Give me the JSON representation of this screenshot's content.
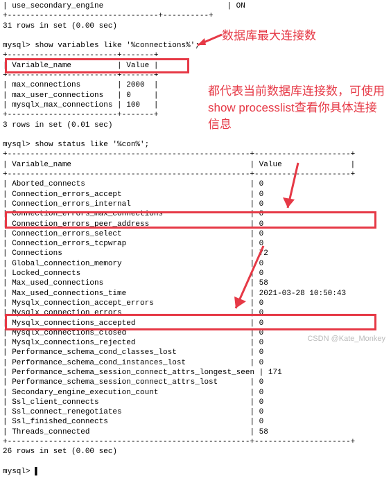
{
  "terminal": {
    "line0": "| use_secondary_engine                           | ON",
    "line1_sep": "+---------------------------------+----------+",
    "line2": "31 rows in set (0.00 sec)",
    "line3": "",
    "line4": "mysql> show variables like '%connections%';",
    "line5": "+------------------------+-------+",
    "line6": "| Variable_name          | Value |",
    "line7": "+------------------------+-------+",
    "line8": "| max_connections        | 2000  |",
    "line8b": "| max_user_connections   | 0     |",
    "line9": "| mysqlx_max_connections | 100   |",
    "line10": "+------------------------+-------+",
    "line11": "3 rows in set (0.01 sec)",
    "line12": "",
    "line13": "mysql> show status like '%con%';",
    "line14": "+-----------------------------------------------------+---------------------+",
    "line15": "| Variable_name                                       | Value               |",
    "line16": "+-----------------------------------------------------+---------------------+",
    "line17": "| Aborted_connects                                    | 0",
    "line18": "| Connection_errors_accept                            | 0",
    "line19": "| Connection_errors_internal                          | 0",
    "line20": "| Connection_errors_max_connections                   | 0",
    "line21": "| Connection_errors_peer_address                      | 0",
    "line22": "| Connection_errors_select                            | 0",
    "line23": "| Connection_errors_tcpwrap                           | 0",
    "line24": "| Connections                                         | 72",
    "line25": "| Global_connection_memory                            | 0",
    "line26": "| Locked_connects                                     | 0",
    "line27": "| Max_used_connections                                | 58",
    "line28": "| Max_used_connections_time                           | 2021-03-28 10:50:43",
    "line29": "| Mysqlx_connection_accept_errors                     | 0",
    "line30": "| Mysqlx_connection_errors                            | 0",
    "line31": "| Mysqlx_connections_accepted                         | 0",
    "line32": "| Mysqlx_connections_closed                           | 0",
    "line33": "| Mysqlx_connections_rejected                         | 0",
    "line34": "| Performance_schema_cond_classes_lost                | 0",
    "line35": "| Performance_schema_cond_instances_lost              | 0",
    "line36": "| Performance_schema_session_connect_attrs_longest_seen | 171",
    "line37": "| Performance_schema_session_connect_attrs_lost       | 0",
    "line38": "| Secondary_engine_execution_count                    | 0",
    "line39": "| Ssl_client_connects                                 | 0",
    "line40": "| Ssl_connect_renegotiates                            | 0",
    "line41": "| Ssl_finished_connects                               | 0",
    "line42": "| Threads_connected                                   | 58",
    "line43": "+-----------------------------------------------------+---------------------+",
    "line44": "26 rows in set (0.00 sec)",
    "line45": "",
    "line46": "mysql> ▌"
  },
  "annotations": {
    "ann1": "数据库最大连接数",
    "ann2": "都代表当前数据库连接数，可使用show processlist查看你具体连接信息"
  },
  "watermark": "CSDN @Kate_Monkey"
}
